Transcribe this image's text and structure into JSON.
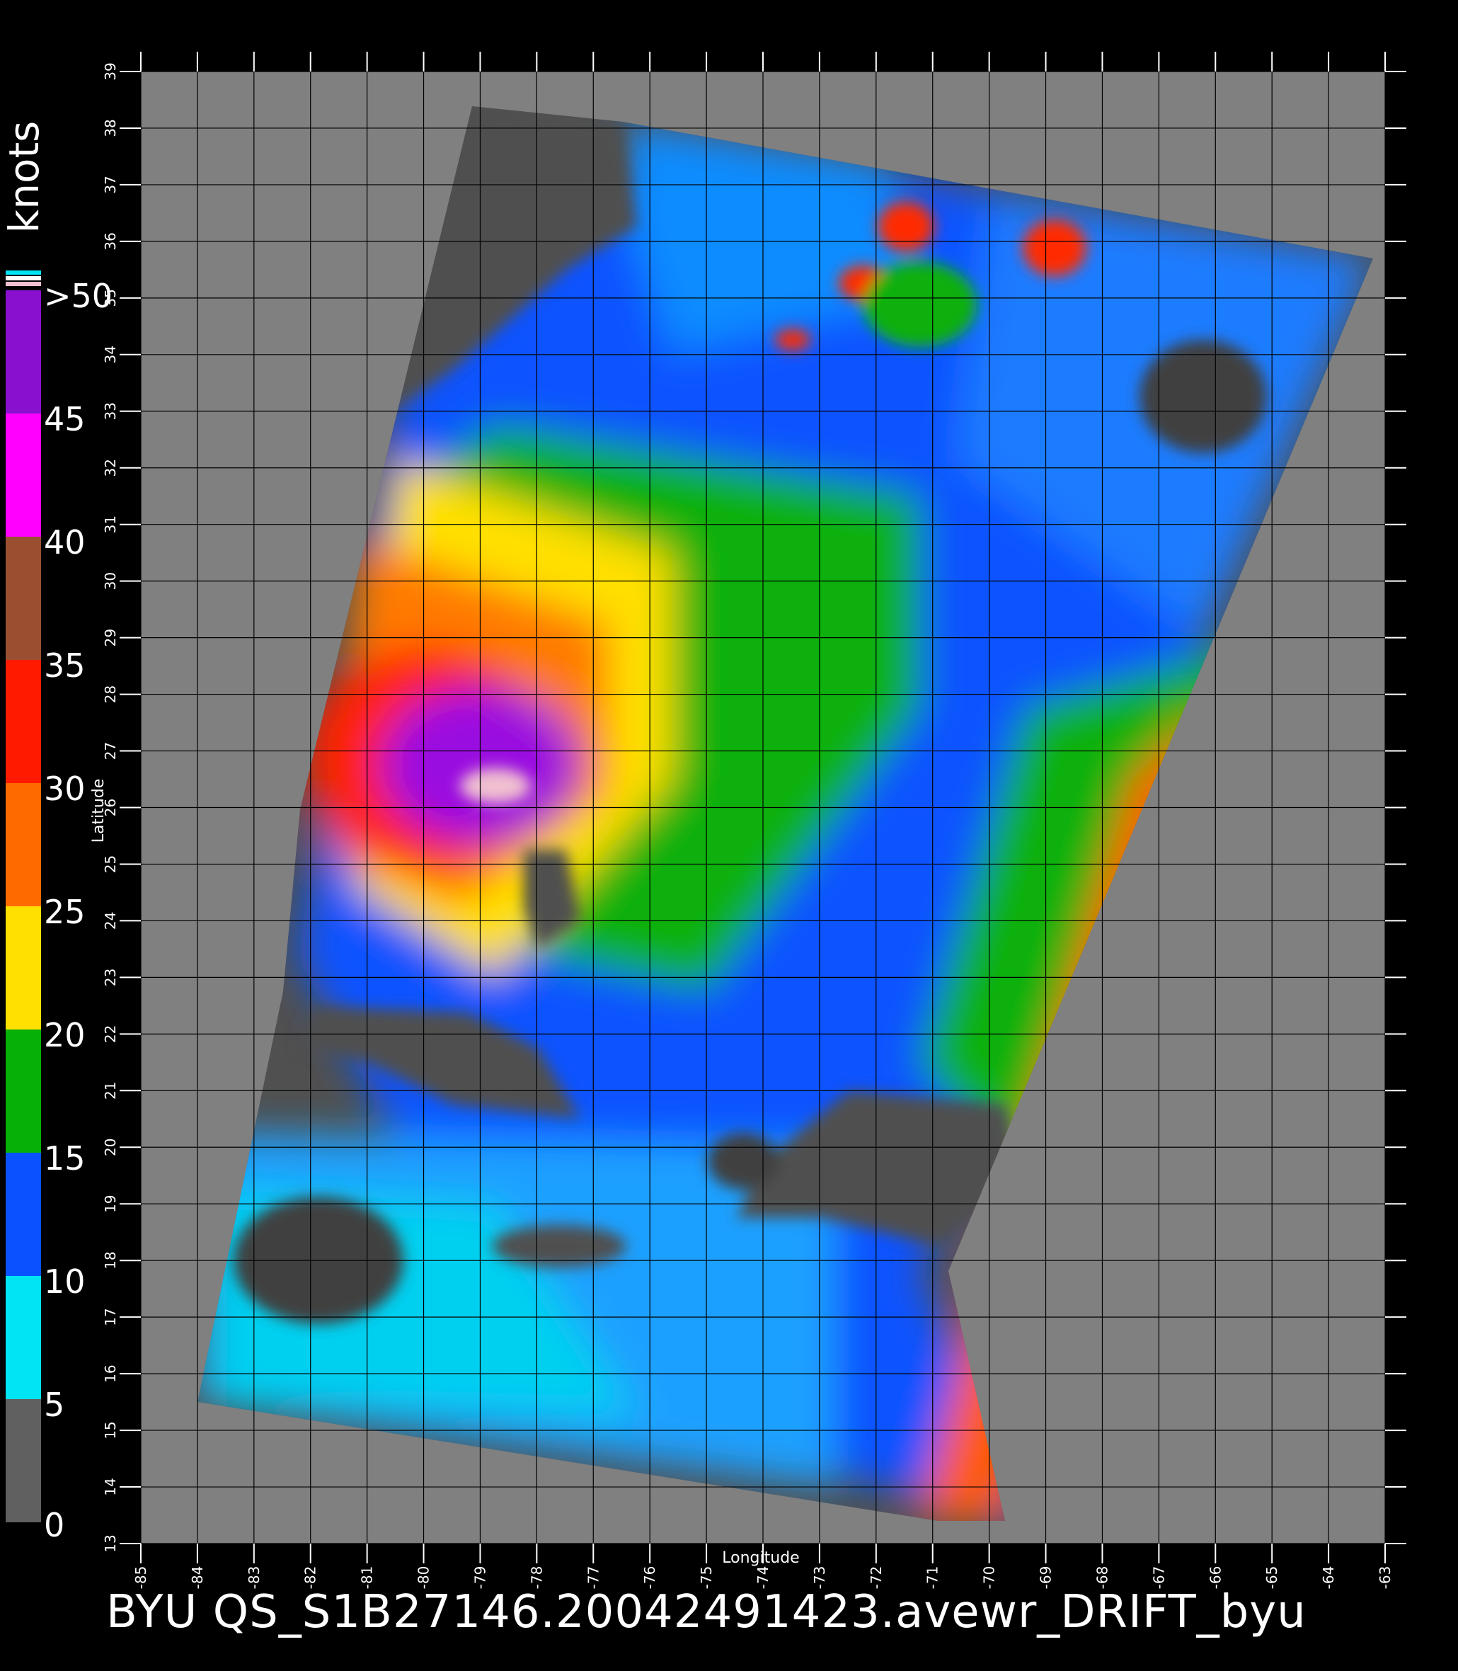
{
  "footer": {
    "title": "BYU  QS_S1B27146.20042491423.avewr_DRIFT_byu"
  },
  "chart_data": {
    "type": "heatmap",
    "xlabel": "Longitude",
    "ylabel": "Latitude",
    "xlim": [
      -85,
      -63
    ],
    "ylim": [
      13,
      39
    ],
    "x_ticks": [
      -85,
      -84,
      -83,
      -82,
      -81,
      -80,
      -79,
      -78,
      -77,
      -76,
      -75,
      -74,
      -73,
      -72,
      -71,
      -70,
      -69,
      -68,
      -67,
      -66,
      -65,
      -64,
      -63
    ],
    "y_ticks": [
      13,
      14,
      15,
      16,
      17,
      18,
      19,
      20,
      21,
      22,
      23,
      24,
      25,
      26,
      27,
      28,
      29,
      30,
      31,
      32,
      33,
      34,
      35,
      36,
      37,
      38,
      39
    ],
    "grid": true,
    "colorbar": {
      "units": "knots",
      "range": [
        0,
        50
      ],
      "labels": [
        "0",
        "5",
        "10",
        "15",
        "20",
        "25",
        "30",
        "35",
        "40",
        "45",
        ">50"
      ],
      "bands": [
        {
          "from": 0,
          "to": 5,
          "color": "#606060"
        },
        {
          "from": 5,
          "to": 10,
          "color": "#00e4f4"
        },
        {
          "from": 10,
          "to": 15,
          "color": "#0a52ff"
        },
        {
          "from": 15,
          "to": 20,
          "color": "#07b007"
        },
        {
          "from": 20,
          "to": 25,
          "color": "#ffe000"
        },
        {
          "from": 25,
          "to": 30,
          "color": "#ff6a00"
        },
        {
          "from": 30,
          "to": 35,
          "color": "#ff1a00"
        },
        {
          "from": 35,
          "to": 40,
          "color": "#9a5030"
        },
        {
          "from": 40,
          "to": 45,
          "color": "#ff00ff"
        },
        {
          "from": 45,
          "to": 50,
          "color": "#8a10d0"
        }
      ],
      "overflow_colors": [
        "#f0c0d0",
        "#ffffff",
        "#00e4f4"
      ]
    },
    "colors": {
      "background": "#000000",
      "no_data": "#808080",
      "land": "#505050",
      "grid": "#000000"
    }
  }
}
